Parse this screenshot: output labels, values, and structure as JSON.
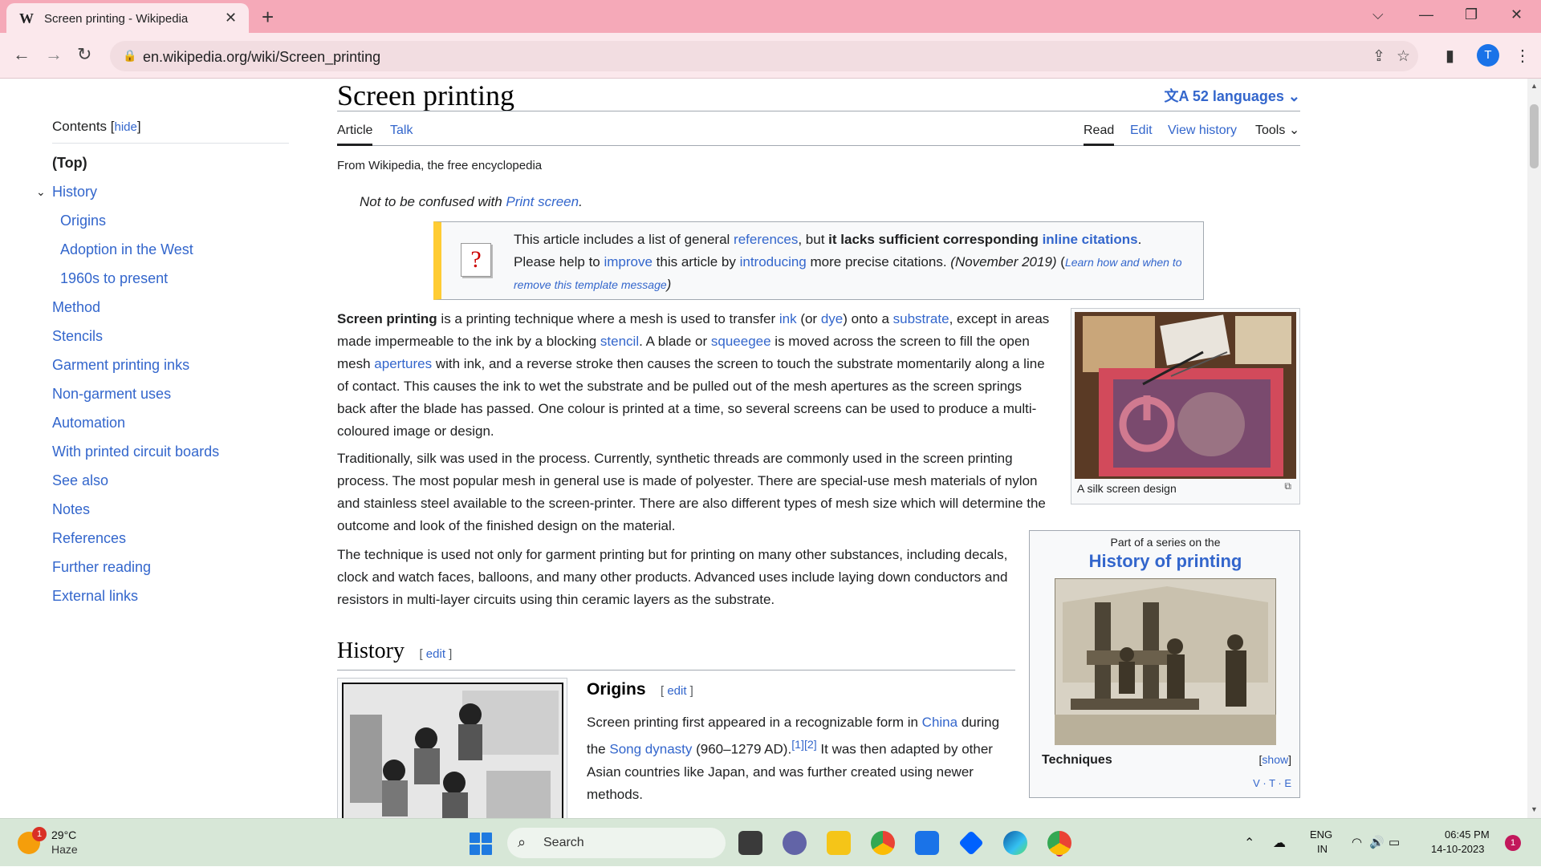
{
  "browser": {
    "tab_title": "Screen printing - Wikipedia",
    "tab_favicon": "W",
    "url": "en.wikipedia.org/wiki/Screen_printing",
    "profile_initial": "T"
  },
  "toc": {
    "heading": "Contents",
    "hide_label": "hide",
    "items": [
      {
        "label": "(Top)"
      },
      {
        "label": "History"
      },
      {
        "label": "Origins"
      },
      {
        "label": "Adoption in the West"
      },
      {
        "label": "1960s to present"
      },
      {
        "label": "Method"
      },
      {
        "label": "Stencils"
      },
      {
        "label": "Garment printing inks"
      },
      {
        "label": "Non-garment uses"
      },
      {
        "label": "Automation"
      },
      {
        "label": "With printed circuit boards"
      },
      {
        "label": "See also"
      },
      {
        "label": "Notes"
      },
      {
        "label": "References"
      },
      {
        "label": "Further reading"
      },
      {
        "label": "External links"
      }
    ]
  },
  "article": {
    "title": "Screen printing",
    "languages": "52 languages",
    "tabs": {
      "article": "Article",
      "talk": "Talk",
      "read": "Read",
      "edit": "Edit",
      "history": "View history",
      "tools": "Tools"
    },
    "from": "From Wikipedia, the free encyclopedia",
    "hatnote_prefix": "Not to be confused with ",
    "hatnote_link": "Print screen",
    "hatnote_suffix": ".",
    "ambox": {
      "t1": "This article includes a list of general ",
      "l1": "references",
      "t2": ", but ",
      "b1": "it lacks sufficient corresponding ",
      "l2": "inline citations",
      "t3": ".",
      "t4": "Please help to ",
      "l3": "improve",
      "t5": " this article by ",
      "l4": "introducing",
      "t6": " more precise citations. ",
      "date": "(November 2019)",
      "t7": " (",
      "l5": "Learn how and when to remove this template message",
      "t8": ")"
    },
    "p1": {
      "bold": "Screen printing",
      "a": " is a printing technique where a mesh is used to transfer ",
      "ink": "ink",
      "b": " (or ",
      "dye": "dye",
      "c": ") onto a ",
      "substrate": "substrate",
      "d": ", except in areas made impermeable to the ink by a blocking ",
      "stencil": "stencil",
      "e": ". A blade or ",
      "squeegee": "squeegee",
      "f": " is moved across the screen to fill the open mesh ",
      "apertures": "apertures",
      "g": " with ink, and a reverse stroke then causes the screen to touch the substrate momentarily along a line of contact. This causes the ink to wet the substrate and be pulled out of the mesh apertures as the screen springs back after the blade has passed. One colour is printed at a time, so several screens can be used to produce a multi-coloured image or design."
    },
    "p2": "Traditionally, silk was used in the process. Currently, synthetic threads are commonly used in the screen printing process. The most popular mesh in general use is made of polyester. There are special-use mesh materials of nylon and stainless steel available to the screen-printer. There are also different types of mesh size which will determine the outcome and look of the finished design on the material.",
    "p3": "The technique is used not only for garment printing but for printing on many other substances, including decals, clock and watch faces, balloons, and many other products. Advanced uses include laying down conductors and resistors in multi-layer circuits using thin ceramic layers as the substrate.",
    "thumb_caption": "A silk screen design",
    "navbox": {
      "above": "Part of a series on the",
      "title": "History of printing",
      "group": "Techniques",
      "show": "show",
      "vte": "V · T · E"
    },
    "h2_history": "History",
    "h3_origins": "Origins",
    "edit_label": "edit",
    "origins": {
      "a": "Screen printing first appeared in a recognizable form in ",
      "china": "China",
      "b": " during the ",
      "song": "Song dynasty",
      "c": " (960–1279 AD).",
      "ref1": "[1]",
      "ref2": "[2]",
      "d": " It was then adapted by other Asian countries like Japan, and was further created using newer methods."
    }
  },
  "taskbar": {
    "weather_badge": "1",
    "temp": "29°C",
    "condition": "Haze",
    "search": "Search",
    "lang1": "ENG",
    "lang2": "IN",
    "time": "06:45 PM",
    "date": "14-10-2023",
    "notif": "1"
  }
}
